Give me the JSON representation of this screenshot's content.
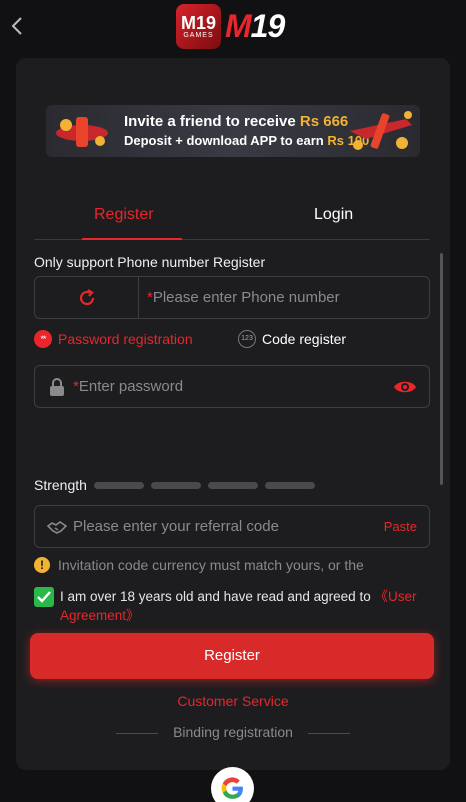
{
  "header": {
    "brand_badge_top": "M19",
    "brand_badge_bottom": "GAMES",
    "brand_text_m": "M",
    "brand_text_19": "19"
  },
  "banner": {
    "line1_text": "Invite a friend to receive",
    "line1_amount": "Rs 666",
    "line2_text": "Deposit + download APP to earn",
    "line2_amount": "Rs 100"
  },
  "tabs": [
    {
      "label": "Register",
      "active": true
    },
    {
      "label": "Login",
      "active": false
    }
  ],
  "form": {
    "section_title": "Only support Phone number Register",
    "required_mark": "*",
    "phone_placeholder": "Please enter Phone number",
    "mode_password": "Password registration",
    "mode_password_badge": "**",
    "mode_code": "Code register",
    "mode_code_badge": "123",
    "password_placeholder": "Enter password",
    "strength_label": "Strength",
    "strength_level": 0,
    "referral_placeholder": "Please enter your referral code",
    "paste_label": "Paste",
    "notice_icon": "!",
    "notice_text": "Invitation code currency must match yours, or the",
    "agree_text": "I am over 18 years old and have read and agreed to ",
    "agree_link": "《User Agreement》",
    "agree_checked": true,
    "register_button": "Register",
    "customer_service": "Customer Service",
    "binding_label": "Binding registration"
  },
  "colors": {
    "accent": "#e8262c",
    "background": "#111113",
    "panel": "#1d1d1f",
    "success": "#2ab84a",
    "warning": "#f2b233"
  },
  "icons": [
    "back-chevron-icon",
    "refresh-icon",
    "lock-icon",
    "eye-icon",
    "handshake-icon",
    "warning-icon",
    "check-icon",
    "google-icon"
  ]
}
